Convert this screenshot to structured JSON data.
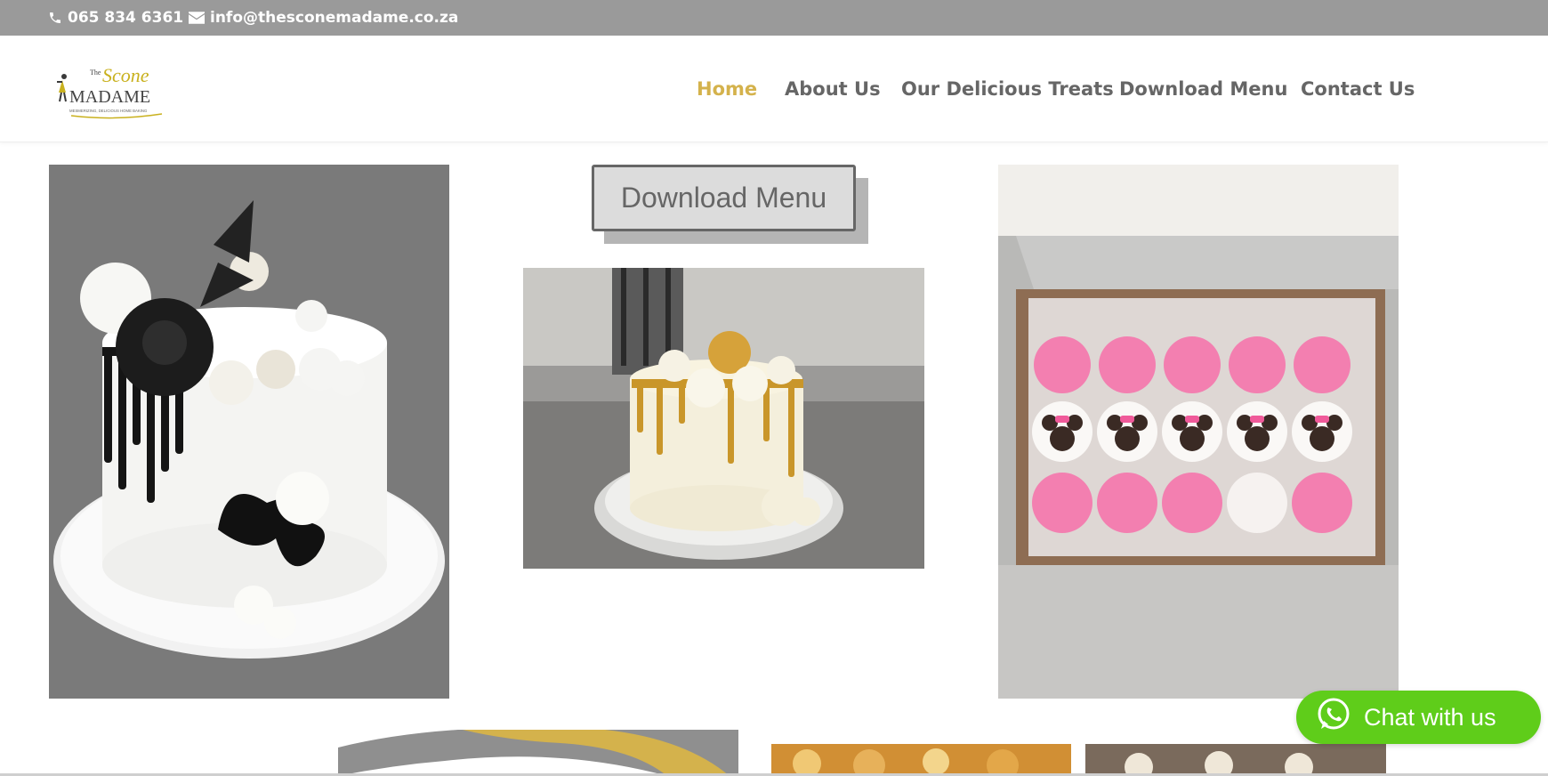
{
  "topbar": {
    "phone": "065 834 6361",
    "email": "info@thesconemadame.co.za",
    "phone_icon": "phone-icon",
    "email_icon": "envelope-icon"
  },
  "logo": {
    "line1": "The",
    "line2": "Scone",
    "line3": "MADAME",
    "tagline": "MESMERIZING, DELICIOUS HOME BAKING"
  },
  "nav": {
    "items": [
      {
        "label": "Home",
        "active": true
      },
      {
        "label": "About Us",
        "active": false
      },
      {
        "label": "Our Delicious Treats",
        "active": false
      },
      {
        "label": "Download Menu",
        "active": false
      },
      {
        "label": "Contact Us",
        "active": false
      }
    ]
  },
  "main": {
    "download_button": "Download Menu"
  },
  "chat": {
    "label": "Chat with us",
    "icon": "whatsapp-icon"
  },
  "colors": {
    "topbar": "#9a9a9a",
    "accent": "#d4b24c",
    "nav_text": "#666666",
    "chat_green": "#5fcd1a"
  }
}
